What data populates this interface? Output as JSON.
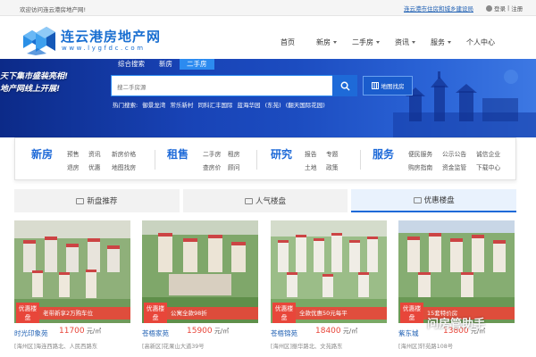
{
  "topbar": {
    "welcome": "欢迎访问连云港房地产网!",
    "gov_link": "连云港市住房和城乡建设局",
    "login": "登录",
    "sep": "|",
    "register": "注册"
  },
  "logo": {
    "name": "连云港房地产网",
    "url": "www.lygfdc.com"
  },
  "nav": [
    {
      "label": "首页",
      "dropdown": false
    },
    {
      "label": "新房",
      "dropdown": true
    },
    {
      "label": "二手房",
      "dropdown": true
    },
    {
      "label": "资讯",
      "dropdown": true
    },
    {
      "label": "服务",
      "dropdown": true
    },
    {
      "label": "个人中心",
      "dropdown": false
    }
  ],
  "banner": {
    "slogan_line1": "天下集市盛装亮相!",
    "slogan_line2": "地产网线上开展!"
  },
  "search": {
    "tabs": [
      "综合搜索",
      "新房",
      "二手房"
    ],
    "active_tab": 2,
    "placeholder": "搜二手房源",
    "map_button": "地图找房",
    "hot_label": "热门搜索:",
    "hot_items": [
      "御景龙湾",
      "常乐新村",
      "同科汇丰国际",
      "蓝海华园",
      "(东苑)",
      "(翻天国际花园)"
    ]
  },
  "categories": [
    {
      "title": "新房",
      "links": [
        [
          "预售",
          "资讯",
          "新房价格"
        ],
        [
          "退房",
          "优惠",
          "地图找房"
        ]
      ]
    },
    {
      "title": "租售",
      "links": [
        [
          "二手房",
          "租房"
        ],
        [
          "查房价",
          "顾问"
        ]
      ]
    },
    {
      "title": "研究",
      "links": [
        [
          "报告",
          "专题"
        ],
        [
          "土地",
          "政策"
        ]
      ]
    },
    {
      "title": "服务",
      "links": [
        [
          "便民服务",
          "公示公告",
          "诚信企业"
        ],
        [
          "购房指南",
          "资金监管",
          "下载中心"
        ]
      ]
    }
  ],
  "tabs": [
    {
      "label": "新盘推荐",
      "active": false
    },
    {
      "label": "人气楼盘",
      "active": false
    },
    {
      "label": "优惠楼盘",
      "active": true
    }
  ],
  "cards": [
    {
      "badge": "优惠楼盘",
      "promo": "老带新享2万购车位",
      "name": "时光印象苑",
      "price": "11700",
      "unit": "元/㎡",
      "addr": "[海州区]海连西路北、人民西路东"
    },
    {
      "badge": "优惠楼盘",
      "promo": "公寓全款98折",
      "name": "苍梧家苑",
      "price": "15900",
      "unit": "元/㎡",
      "addr": "[高新区]花果山大道39号"
    },
    {
      "badge": "优惠楼盘",
      "promo": "全款优惠50元每平",
      "name": "苍梧锦苑",
      "price": "18400",
      "unit": "元/㎡",
      "addr": "[海州区]振华路北、文苑路东"
    },
    {
      "badge": "优惠楼盘",
      "promo": "15套特价房",
      "name": "紫东城",
      "price": "13800",
      "unit": "元/㎡",
      "addr": "[海州区]轩苑路108号"
    }
  ],
  "watermark": "问房管助手",
  "colors": {
    "brand_blue": "#1e6ad8",
    "promo_red": "#e8463a"
  }
}
